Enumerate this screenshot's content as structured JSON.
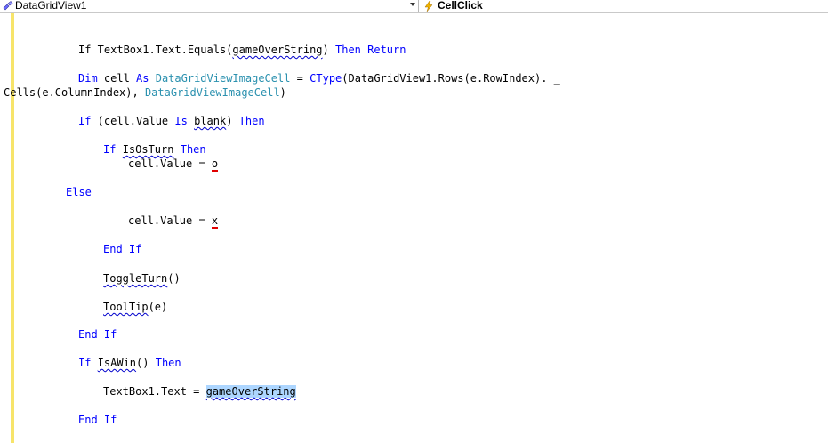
{
  "toolbar": {
    "object_dropdown": "DataGridView1",
    "event_dropdown": "CellClick"
  },
  "code": {
    "l1_a": "If TextBox1.Text.Equals(",
    "l1_b": "gameOverString",
    "l1_c": ") ",
    "l1_d": "Then Return",
    "l2_kw1": "Dim",
    "l2_a": " cell ",
    "l2_kw2": "As",
    "l2_ty1": "DataGridViewImageCell",
    "l2_b": " = ",
    "l2_kw3": "CType",
    "l2_c": "(DataGridView1.Rows(e.RowIndex). _",
    "l3_a": "Cells(e.ColumnIndex), ",
    "l3_ty": "DataGridViewImageCell",
    "l3_b": ")",
    "l4_kw": "If",
    "l4_a": " (cell.Value ",
    "l4_kw2": "Is",
    "l4_b": "blank",
    "l4_c": ") ",
    "l4_kw3": "Then",
    "l5_kw": "If",
    "l5_a": "IsOsTurn",
    "l5_kw2": "Then",
    "l6_a": "cell.Value = ",
    "l6_b": "o",
    "l7_kw": "Else",
    "l8_a": "cell.Value = ",
    "l8_b": "x",
    "l9_kw": "End If",
    "l10_a": "ToggleTurn",
    "l10_b": "()",
    "l11_a": "ToolTip",
    "l11_b": "(e)",
    "l12_kw": "End If",
    "l13_kw": "If",
    "l13_a": "IsAWin",
    "l13_b": "() ",
    "l13_kw2": "Then",
    "l14_a": "TextBox1.Text = ",
    "l14_b": "gameOverString",
    "l15_kw": "End If"
  },
  "colors": {
    "keyword": "#0000ff",
    "type": "#2b91af",
    "selection": "#add6ff",
    "margin_change_bar": "#f7e46a"
  },
  "icons": {
    "object": "class-object-icon",
    "event": "lightning-event-icon"
  }
}
